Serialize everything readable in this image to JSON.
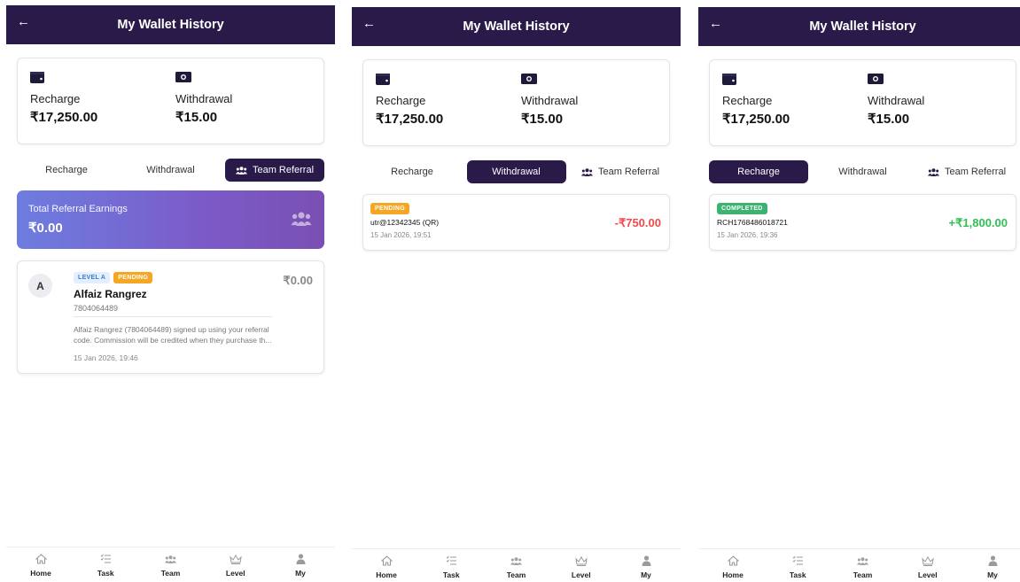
{
  "screens": [
    {
      "header": {
        "title": "My Wallet History"
      },
      "summary": {
        "recharge_label": "Recharge",
        "recharge_amount": "₹17,250.00",
        "withdrawal_label": "Withdrawal",
        "withdrawal_amount": "₹15.00"
      },
      "tabs": [
        {
          "label": "Recharge"
        },
        {
          "label": "Withdrawal"
        },
        {
          "label": "Team Referral"
        }
      ],
      "active_tab": "Team Referral",
      "referral_summary": {
        "label": "Total Referral Earnings",
        "amount": "₹0.00"
      },
      "referral": {
        "avatar_initial": "A",
        "level_badge": "LEVEL A",
        "status_badge": "PENDING",
        "name": "Alfaiz Rangrez",
        "phone": "7804064489",
        "amount": "₹0.00",
        "description": "Alfaiz Rangrez (7804064489) signed up using your referral code. Commission will be credited when they purchase th...",
        "date": "15 Jan 2026, 19:46"
      }
    },
    {
      "header": {
        "title": "My Wallet History"
      },
      "summary": {
        "recharge_label": "Recharge",
        "recharge_amount": "₹17,250.00",
        "withdrawal_label": "Withdrawal",
        "withdrawal_amount": "₹15.00"
      },
      "tabs": [
        {
          "label": "Recharge"
        },
        {
          "label": "Withdrawal"
        },
        {
          "label": "Team Referral"
        }
      ],
      "active_tab": "Withdrawal",
      "transaction": {
        "status_badge": "PENDING",
        "reference": "utr@12342345 (QR)",
        "date": "15 Jan 2026, 19:51",
        "amount": "-₹750.00"
      }
    },
    {
      "header": {
        "title": "My Wallet History"
      },
      "summary": {
        "recharge_label": "Recharge",
        "recharge_amount": "₹17,250.00",
        "withdrawal_label": "Withdrawal",
        "withdrawal_amount": "₹15.00"
      },
      "tabs": [
        {
          "label": "Recharge"
        },
        {
          "label": "Withdrawal"
        },
        {
          "label": "Team Referral"
        }
      ],
      "active_tab": "Recharge",
      "transaction": {
        "status_badge": "COMPLETED",
        "reference": "RCH1768486018721",
        "date": "15 Jan 2026, 19:36",
        "amount": "+₹1,800.00"
      }
    }
  ],
  "bottom_nav": [
    {
      "label": "Home",
      "icon": "home-icon"
    },
    {
      "label": "Task",
      "icon": "task-list-icon"
    },
    {
      "label": "Team",
      "icon": "team-icon"
    },
    {
      "label": "Level",
      "icon": "crown-icon"
    },
    {
      "label": "My",
      "icon": "user-icon"
    }
  ],
  "colors": {
    "header": "#2a1a4a",
    "active_tab": "#2a1a4a",
    "pending": "#f5a623",
    "completed": "#3cb371",
    "negative": "#f04a4a",
    "positive": "#2fbf55"
  }
}
